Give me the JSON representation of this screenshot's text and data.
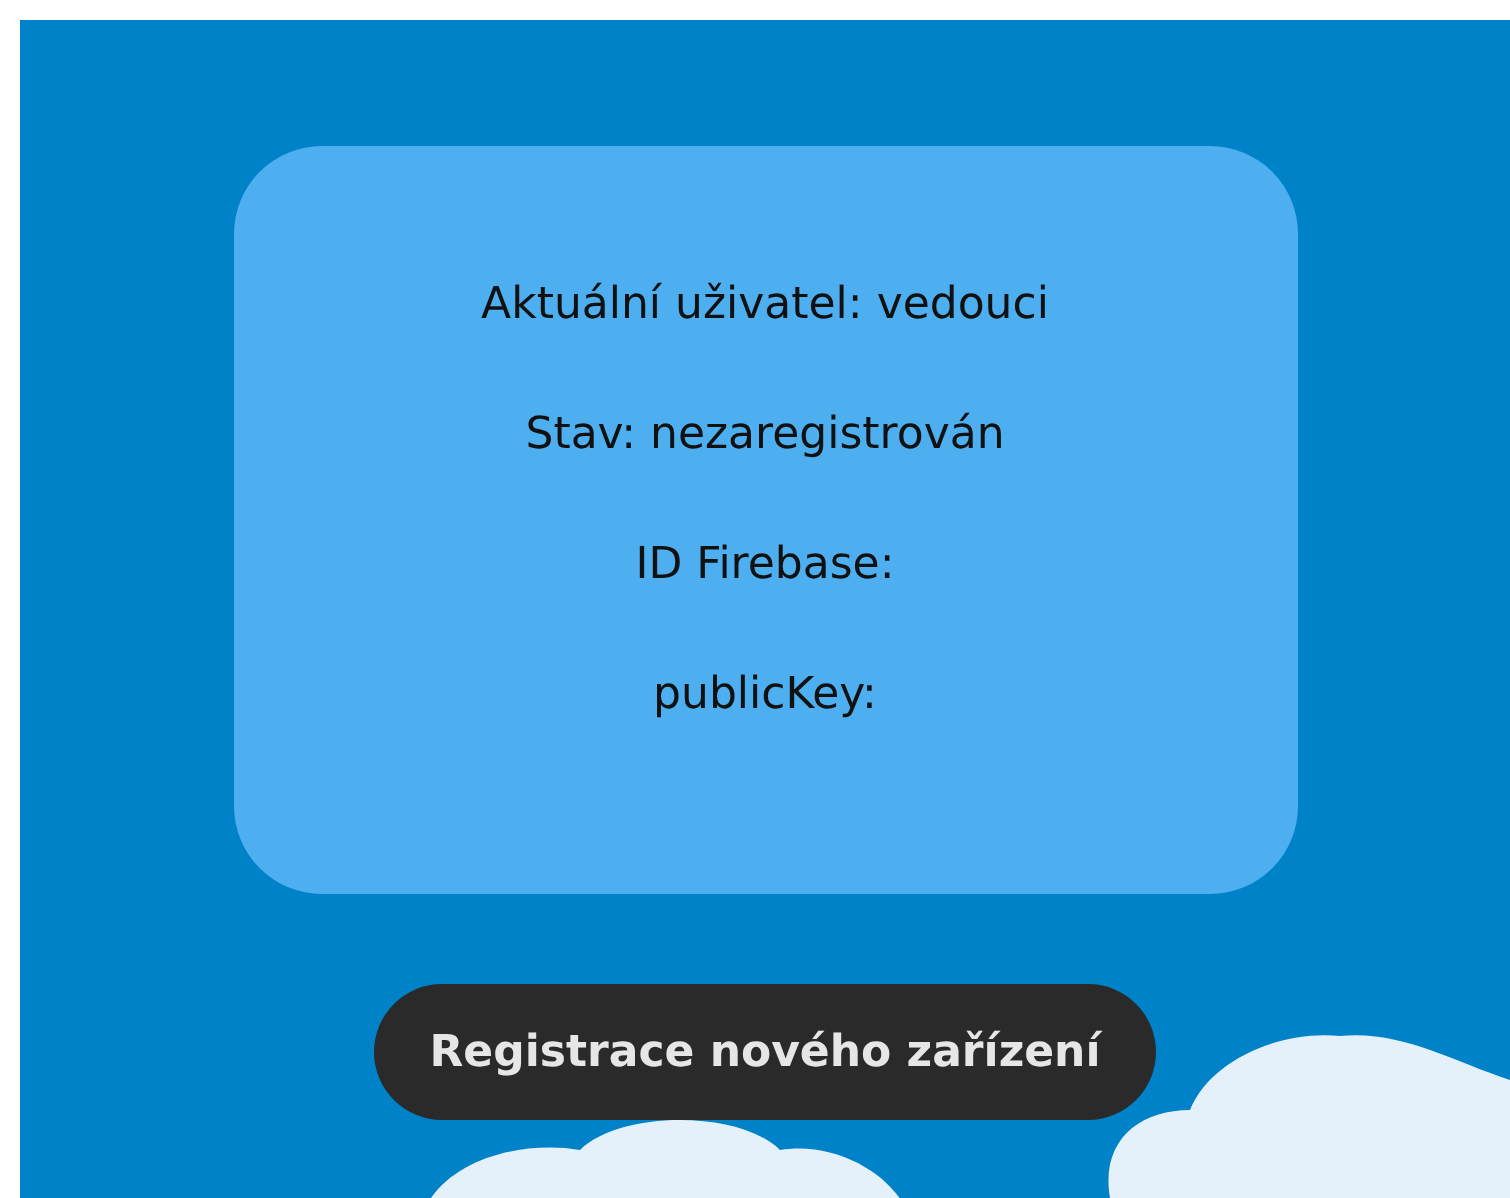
{
  "info_card": {
    "lines": [
      "Aktuální uživatel: vedouci",
      "Stav: nezaregistrován",
      "ID Firebase:",
      "publicKey:"
    ]
  },
  "register_button": {
    "label": "Registrace nového zařízení"
  }
}
